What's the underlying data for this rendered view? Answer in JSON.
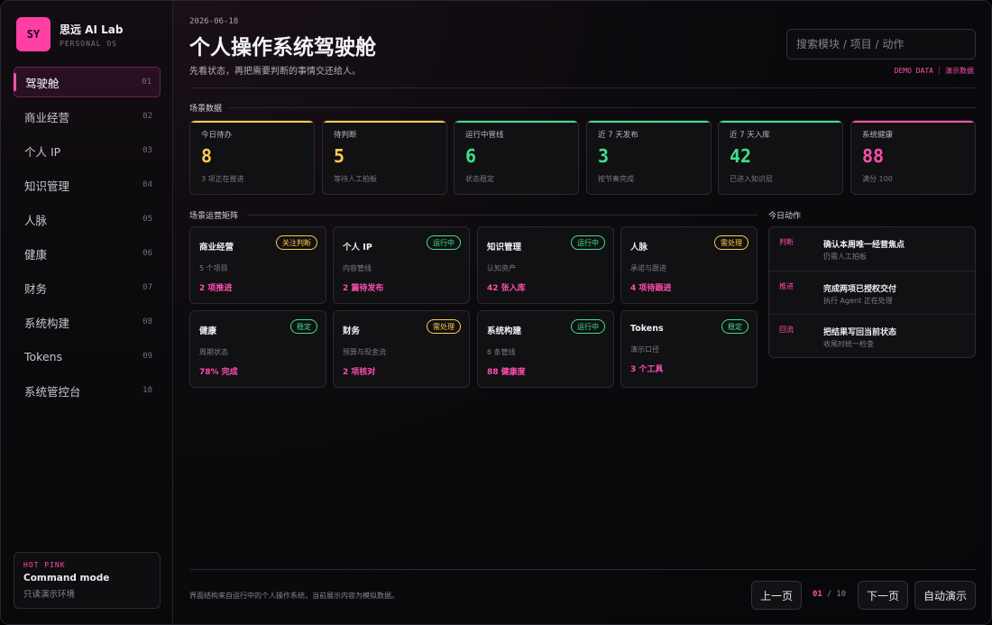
{
  "brand": {
    "logo": "SY",
    "name": "思远 AI Lab",
    "sub": "PERSONAL OS"
  },
  "nav": [
    {
      "label": "驾驶舱",
      "num": "01",
      "active": true
    },
    {
      "label": "商业经营",
      "num": "02"
    },
    {
      "label": "个人 IP",
      "num": "03"
    },
    {
      "label": "知识管理",
      "num": "04"
    },
    {
      "label": "人脉",
      "num": "05"
    },
    {
      "label": "健康",
      "num": "06"
    },
    {
      "label": "财务",
      "num": "07"
    },
    {
      "label": "系统构建",
      "num": "08"
    },
    {
      "label": "Tokens",
      "num": "09"
    },
    {
      "label": "系统管控台",
      "num": "10"
    }
  ],
  "command": {
    "tag": "HOT PINK",
    "title": "Command mode",
    "sub": "只读演示环境"
  },
  "header": {
    "date": "2026-06-18",
    "title": "个人操作系统驾驶舱",
    "subtitle": "先看状态，再把需要判断的事情交还给人。",
    "search_placeholder": "搜索模块 / 项目 / 动作",
    "demo_a": "DEMO DATA",
    "demo_b": "演示数据"
  },
  "sections": {
    "metrics": "场景数据",
    "matrix": "场景运营矩阵",
    "actions": "今日动作"
  },
  "metrics": [
    {
      "label": "今日待办",
      "value": "8",
      "sub": "3 项正在推进",
      "color": "#ffc94d"
    },
    {
      "label": "待判断",
      "value": "5",
      "sub": "等待人工拍板",
      "color": "#ffc94d"
    },
    {
      "label": "运行中管线",
      "value": "6",
      "sub": "状态稳定",
      "color": "#3ee08a"
    },
    {
      "label": "近 7 天发布",
      "value": "3",
      "sub": "按节奏完成",
      "color": "#3ee08a"
    },
    {
      "label": "近 7 天入库",
      "value": "42",
      "sub": "已进入知识层",
      "color": "#3ee08a"
    },
    {
      "label": "系统健康",
      "value": "88",
      "sub": "满分 100",
      "color": "#ff4fae"
    }
  ],
  "cards": [
    {
      "title": "商业经营",
      "badge": "关注判断",
      "badge_color": "#ffc94d",
      "desc": "5 个项目",
      "stat": "2 项推进"
    },
    {
      "title": "个人 IP",
      "badge": "运行中",
      "badge_color": "#3ee08a",
      "desc": "内容管线",
      "stat": "2 篇待发布"
    },
    {
      "title": "知识管理",
      "badge": "运行中",
      "badge_color": "#3ee08a",
      "desc": "认知资产",
      "stat": "42 张入库"
    },
    {
      "title": "人脉",
      "badge": "需处理",
      "badge_color": "#ffc94d",
      "desc": "承诺与跟进",
      "stat": "4 项待跟进"
    },
    {
      "title": "健康",
      "badge": "稳定",
      "badge_color": "#3ee08a",
      "desc": "周期状态",
      "stat": "78% 完成"
    },
    {
      "title": "财务",
      "badge": "需处理",
      "badge_color": "#ffc94d",
      "desc": "预算与现金流",
      "stat": "2 项核对"
    },
    {
      "title": "系统构建",
      "badge": "运行中",
      "badge_color": "#3ee08a",
      "desc": "6 条管线",
      "stat": "88 健康度"
    },
    {
      "title": "Tokens",
      "badge": "稳定",
      "badge_color": "#3ee08a",
      "desc": "演示口径",
      "stat": "3 个工具"
    }
  ],
  "actions": [
    {
      "tag": "判断",
      "title": "确认本周唯一经营焦点",
      "sub": "仍需人工拍板"
    },
    {
      "tag": "推进",
      "title": "完成两项已授权交付",
      "sub": "执行 Agent 正在处理"
    },
    {
      "tag": "回流",
      "title": "把结果写回当前状态",
      "sub": "收尾时统一检查"
    }
  ],
  "footer": {
    "note": "界面结构来自运行中的个人操作系统，当前展示内容为模拟数据。",
    "prev": "上一页",
    "page_cur": "01",
    "page_total": "10",
    "next": "下一页",
    "auto": "自动演示"
  },
  "colors": {
    "accent": "#ff4fae",
    "warn": "#ffc94d",
    "ok": "#3ee08a"
  }
}
